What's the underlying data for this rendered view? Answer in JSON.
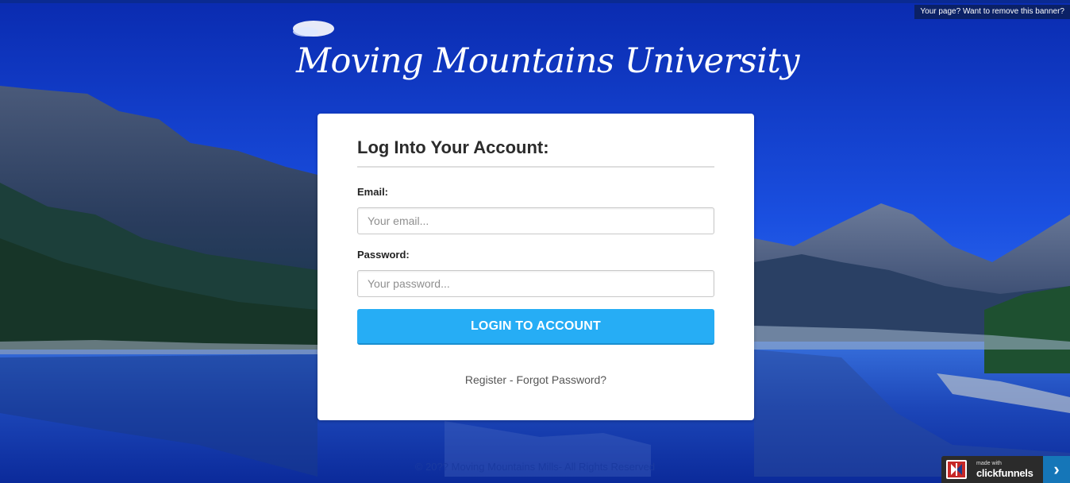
{
  "banner": {
    "text": "Your page? Want to remove this banner?"
  },
  "site": {
    "title": "Moving Mountains University"
  },
  "login": {
    "heading": "Log Into Your Account:",
    "email_label": "Email:",
    "email_placeholder": "Your email...",
    "email_value": "",
    "password_label": "Password:",
    "password_placeholder": "Your password...",
    "password_value": "",
    "submit_label": "LOGIN TO ACCOUNT",
    "register_link": "Register",
    "separator": " - ",
    "forgot_link": "Forgot Password?"
  },
  "footer": {
    "text": "© 20?? Moving Mountains Mills- All Rights Reserved"
  },
  "badge": {
    "small_text": "made with",
    "brand_text": "clickfunnels",
    "arrow_icon": "chevron-right-icon"
  },
  "colors": {
    "button": "#26adf5",
    "sky": "#0b2fb8",
    "badge_bg": "#2b2b2b",
    "badge_arrow_bg": "#1576b8"
  }
}
